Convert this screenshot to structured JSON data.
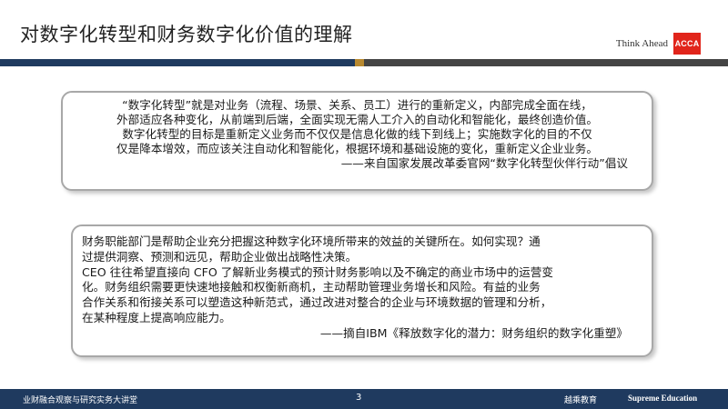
{
  "header": {
    "title": "对数字化转型和财务数字化价值的理解",
    "brand_tagline": "Think Ahead",
    "brand_logo_text": "ACCA",
    "colors": {
      "navy": "#1f3a5f",
      "gold": "#b8892f",
      "brand_red": "#e1251b"
    }
  },
  "quote1": {
    "lines": [
      "“数字化转型”就是对业务（流程、场景、关系、员工）进行的重新定义，内部完成全面在线，",
      "外部适应各种变化，从前端到后端，全面实现无需人工介入的自动化和智能化，最终创造价值。",
      "数字化转型的目标是重新定义业务而不仅仅是信息化做的线下到线上；实施数字化的目的不仅",
      "仅是降本增效，而应该关注自动化和智能化，根据环境和基础设施的变化，重新定义企业业务。"
    ],
    "source": "——来自国家发展改革委官网“数字化转型伙伴行动”倡议"
  },
  "quote2": {
    "lines": [
      "财务职能部门是帮助企业充分把握这种数字化环境所带来的效益的关键所在。如何实现？通",
      "过提供洞察、预测和远见，帮助企业做出战略性决策。",
      "CEO 往往希望直接向 CFO 了解新业务模式的预计财务影响以及不确定的商业市场中的运营变",
      "化。财务组织需要更快速地接触和权衡新商机，主动帮助管理业务增长和风险。有益的业务",
      "合作关系和衔接关系可以塑造这种新范式，通过改进对整合的企业与环境数据的管理和分析，",
      "在某种程度上提高响应能力。"
    ],
    "source": "——摘自IBM《释放数字化的潜力：财务组织的数字化重塑》"
  },
  "footer": {
    "left_text": "业财融合观察与研究实务大讲堂",
    "page_number": "3",
    "brand_cn": "越乘教育",
    "brand_en": "Supreme Education"
  }
}
